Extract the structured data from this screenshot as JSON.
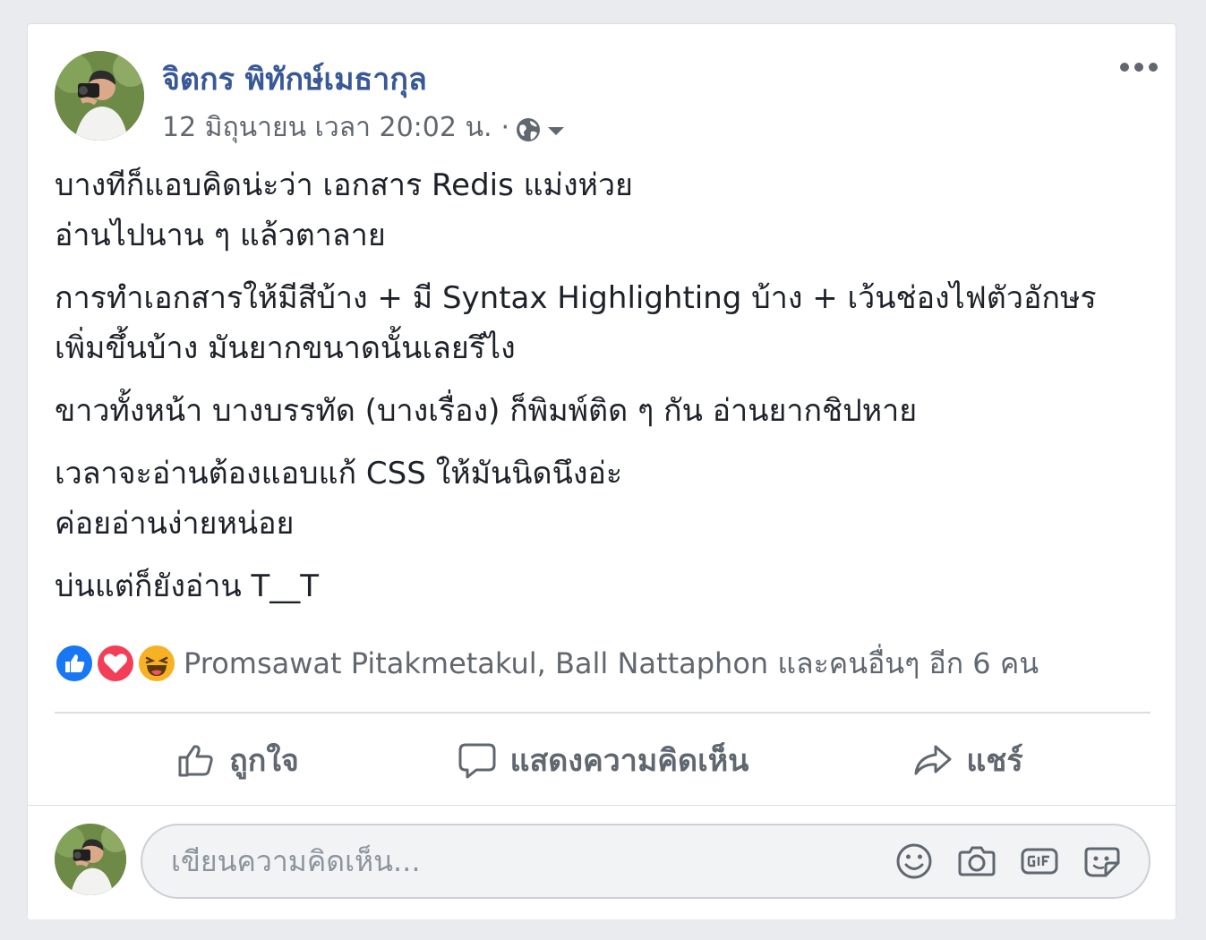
{
  "post": {
    "author": "จิตกร พิทักษ์เมธากุล",
    "date": "12 มิถุนายน เวลา 20:02 น.",
    "separator": "·",
    "privacy_icon": "globe-icon",
    "paragraphs": [
      "บางทีก็แอบคิดน่ะว่า เอกสาร Redis แม่งห่วย\nอ่านไปนาน ๆ แล้วตาลาย",
      "การทำเอกสารให้มีสีบ้าง + มี Syntax Highlighting บ้าง + เว้นช่องไฟตัวอักษรเพิ่มขึ้นบ้าง มันยากขนาดนั้นเลยรึไง",
      "ขาวทั้งหน้า บางบรรทัด (บางเรื่อง) ก็พิมพ์ติด ๆ กัน อ่านยากชิปหาย",
      "เวลาจะอ่านต้องแอบแก้ CSS ให้มันนิดนึงอ่ะ\nค่อยอ่านง่ายหน่อย",
      "บ่นแต่ก็ยังอ่าน T__T"
    ]
  },
  "reactions": {
    "icons": [
      "like-icon",
      "love-icon",
      "haha-icon"
    ],
    "summary": "Promsawat Pitakmetakul, Ball Nattaphon และคนอื่นๆ อีก 6 คน"
  },
  "actions": {
    "like": "ถูกใจ",
    "comment": "แสดงความคิดเห็น",
    "share": "แชร์"
  },
  "comment_box": {
    "placeholder": "เขียนความคิดเห็น...",
    "tools": [
      "emoji-icon",
      "camera-icon",
      "gif-icon",
      "sticker-icon"
    ]
  },
  "colors": {
    "author": "#385898",
    "like": "#1877f2",
    "love": "#f33e58",
    "haha": "#f7b125"
  }
}
